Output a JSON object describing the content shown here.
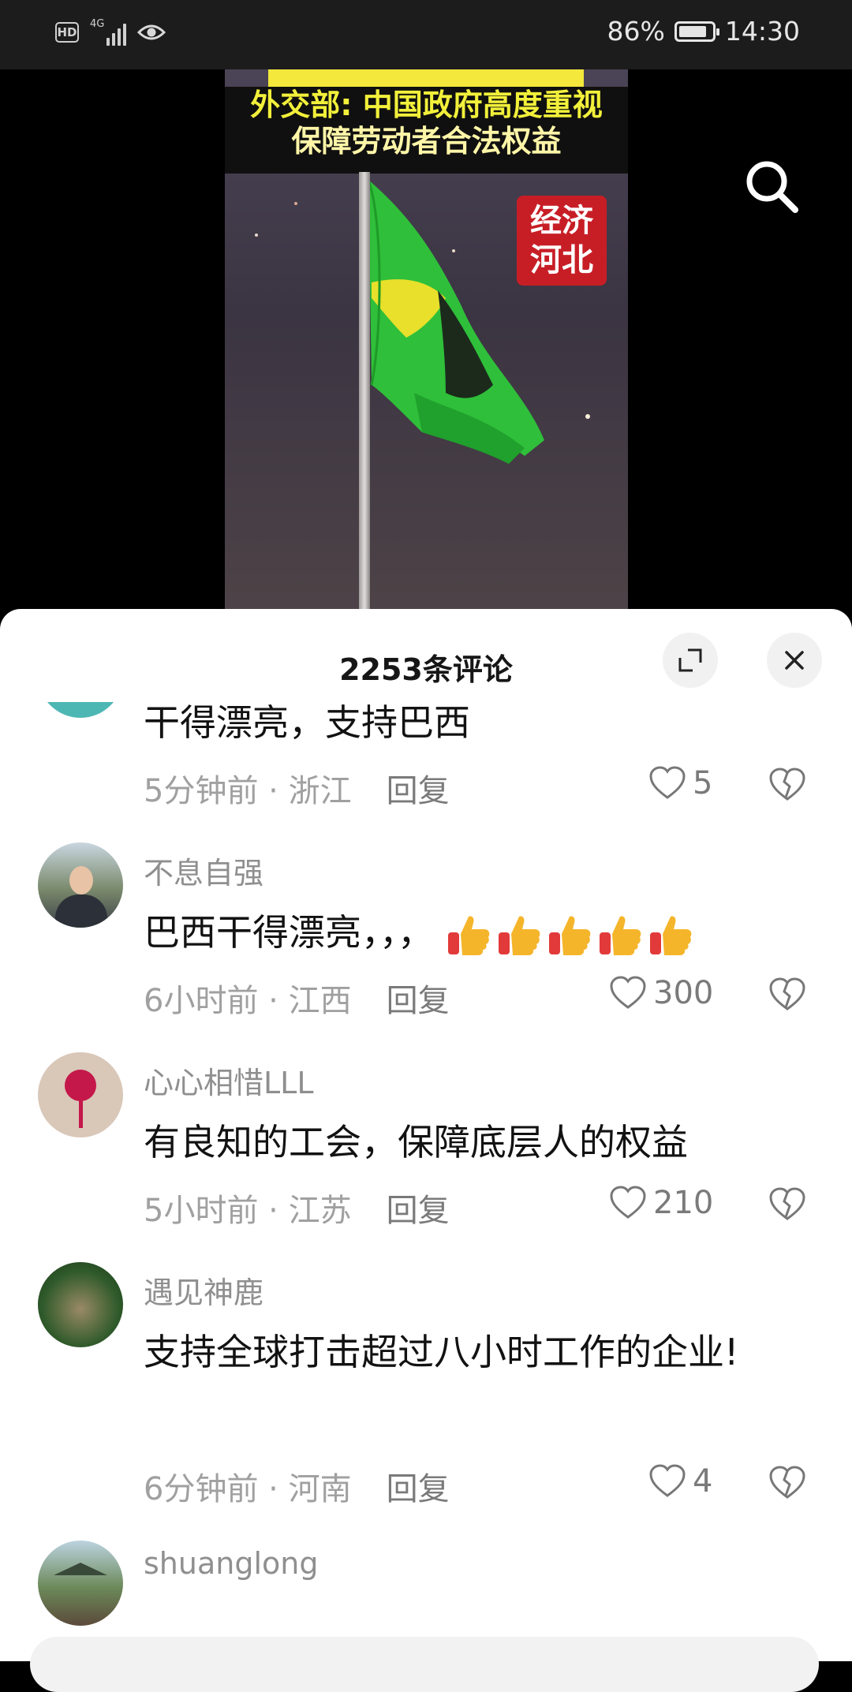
{
  "status_bar": {
    "hd_label": "HD",
    "network": "4G",
    "battery_percent": "86%",
    "battery_level": 0.86,
    "time": "14:30"
  },
  "video": {
    "headline_line1": "外交部: 中国政府高度重视",
    "headline_line2": "保障劳动者合法权益",
    "badge_line1": "经济",
    "badge_line2": "河北"
  },
  "sheet": {
    "title": "2253条评论"
  },
  "comments": [
    {
      "username": "",
      "text": "干得漂亮，支持巴西",
      "time": "5分钟前",
      "location": "浙江",
      "reply_label": "回复",
      "likes": "5"
    },
    {
      "username": "不息自强",
      "text": "巴西干得漂亮，，，",
      "emoji_count": 5,
      "time": "6小时前",
      "location": "江西",
      "reply_label": "回复",
      "likes": "300"
    },
    {
      "username": "心心相惜LLL",
      "text": "有良知的工会，保障底层人的权益",
      "time": "5小时前",
      "location": "江苏",
      "reply_label": "回复",
      "likes": "210"
    },
    {
      "username": "遇见神鹿",
      "text": "支持全球打击超过八小时工作的企业!",
      "time": "6分钟前",
      "location": "河南",
      "reply_label": "回复",
      "likes": "4"
    },
    {
      "username": "shuanglong",
      "text": ""
    }
  ],
  "icons": {
    "search": "search-icon",
    "expand": "expand-icon",
    "close": "close-icon",
    "like": "heart-icon",
    "dislike": "broken-heart-icon",
    "emoji": "thumbs-up-icon"
  }
}
